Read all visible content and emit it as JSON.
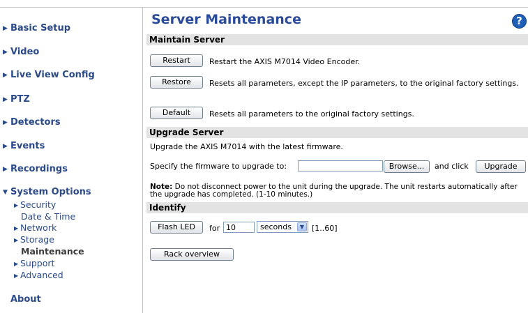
{
  "sidebar": {
    "items": [
      {
        "label": "Basic Setup"
      },
      {
        "label": "Video"
      },
      {
        "label": "Live View Config"
      },
      {
        "label": "PTZ"
      },
      {
        "label": "Detectors"
      },
      {
        "label": "Events"
      },
      {
        "label": "Recordings"
      },
      {
        "label": "System Options"
      },
      {
        "label": "About"
      }
    ],
    "system_options_sub": [
      {
        "label": "Security"
      },
      {
        "label": "Date & Time"
      },
      {
        "label": "Network"
      },
      {
        "label": "Storage"
      },
      {
        "label": "Maintenance"
      },
      {
        "label": "Support"
      },
      {
        "label": "Advanced"
      }
    ]
  },
  "main": {
    "title": "Server Maintenance",
    "help_icon": "?",
    "maintain": {
      "header": "Maintain Server",
      "restart_label": "Restart",
      "restart_desc": "Restart the AXIS M7014 Video Encoder.",
      "restore_label": "Restore",
      "restore_desc": "Resets all parameters, except the IP parameters, to the original factory settings.",
      "default_label": "Default",
      "default_desc": "Resets all parameters to the original factory settings."
    },
    "upgrade": {
      "header": "Upgrade Server",
      "intro": "Upgrade the AXIS M7014 with the latest firmware.",
      "specify_label": "Specify the firmware to upgrade to:",
      "file_value": "",
      "browse_label": "Browse...",
      "and_click": "and click",
      "upgrade_label": "Upgrade",
      "note_label": "Note:",
      "note_text": " Do not disconnect power to the unit during the upgrade. The unit restarts automatically after the upgrade has completed. (1-10 minutes.)"
    },
    "identify": {
      "header": "Identify",
      "flash_label": "Flash LED",
      "for_label": "for",
      "duration_value": "10",
      "unit_selected": "seconds",
      "range_hint": "[1..60]",
      "rack_label": "Rack overview"
    }
  },
  "colors": {
    "link": "#2a4a8a",
    "title": "#2a4a9a",
    "section_bg": "#e3e3e3",
    "help_bg": "#1f5fb8"
  },
  "icons": {
    "nav_arrow": "triangle-right-icon",
    "nav_arrow_open": "triangle-down-icon",
    "help": "help-icon",
    "select_chevron": "chevron-down-icon"
  }
}
